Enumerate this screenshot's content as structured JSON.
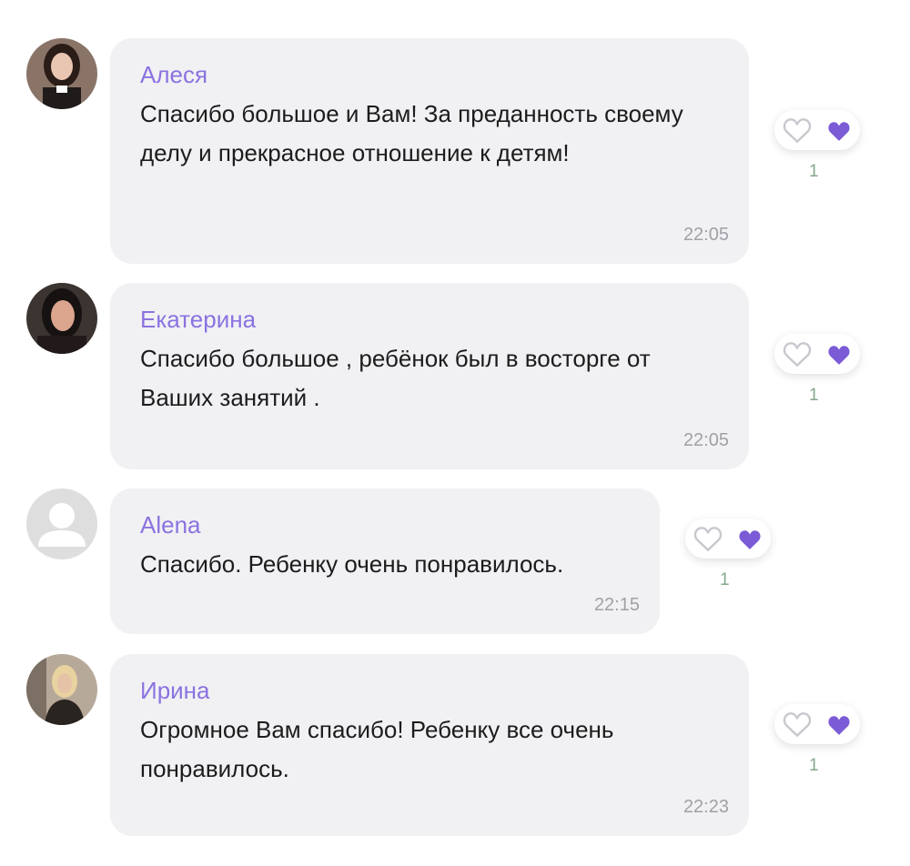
{
  "comments": [
    {
      "author": "Алеся",
      "text": "Спасибо большое и Вам! За преданность своему делу и прекрасное отношение к детям!",
      "time": "22:05",
      "likes": "1",
      "avatar": "avatar-alesya"
    },
    {
      "author": "Екатерина",
      "text": "Спасибо большое , ребёнок был в восторге от Ваших занятий .",
      "time": "22:05",
      "likes": "1",
      "avatar": "avatar-ekaterina"
    },
    {
      "author": "Alena",
      "text": "Спасибо. Ребенку очень понравилось.",
      "time": "22:15",
      "likes": "1",
      "avatar": "default-user-icon"
    },
    {
      "author": "Ирина",
      "text": "Огромное Вам спасибо! Ребенку все очень понравилось.",
      "time": "22:23",
      "likes": "1",
      "avatar": "avatar-irina"
    }
  ],
  "colors": {
    "author": "#8b72e0",
    "bubble": "#f1f1f4",
    "heart": "#7b5bd6",
    "likes": "#86a88c"
  }
}
